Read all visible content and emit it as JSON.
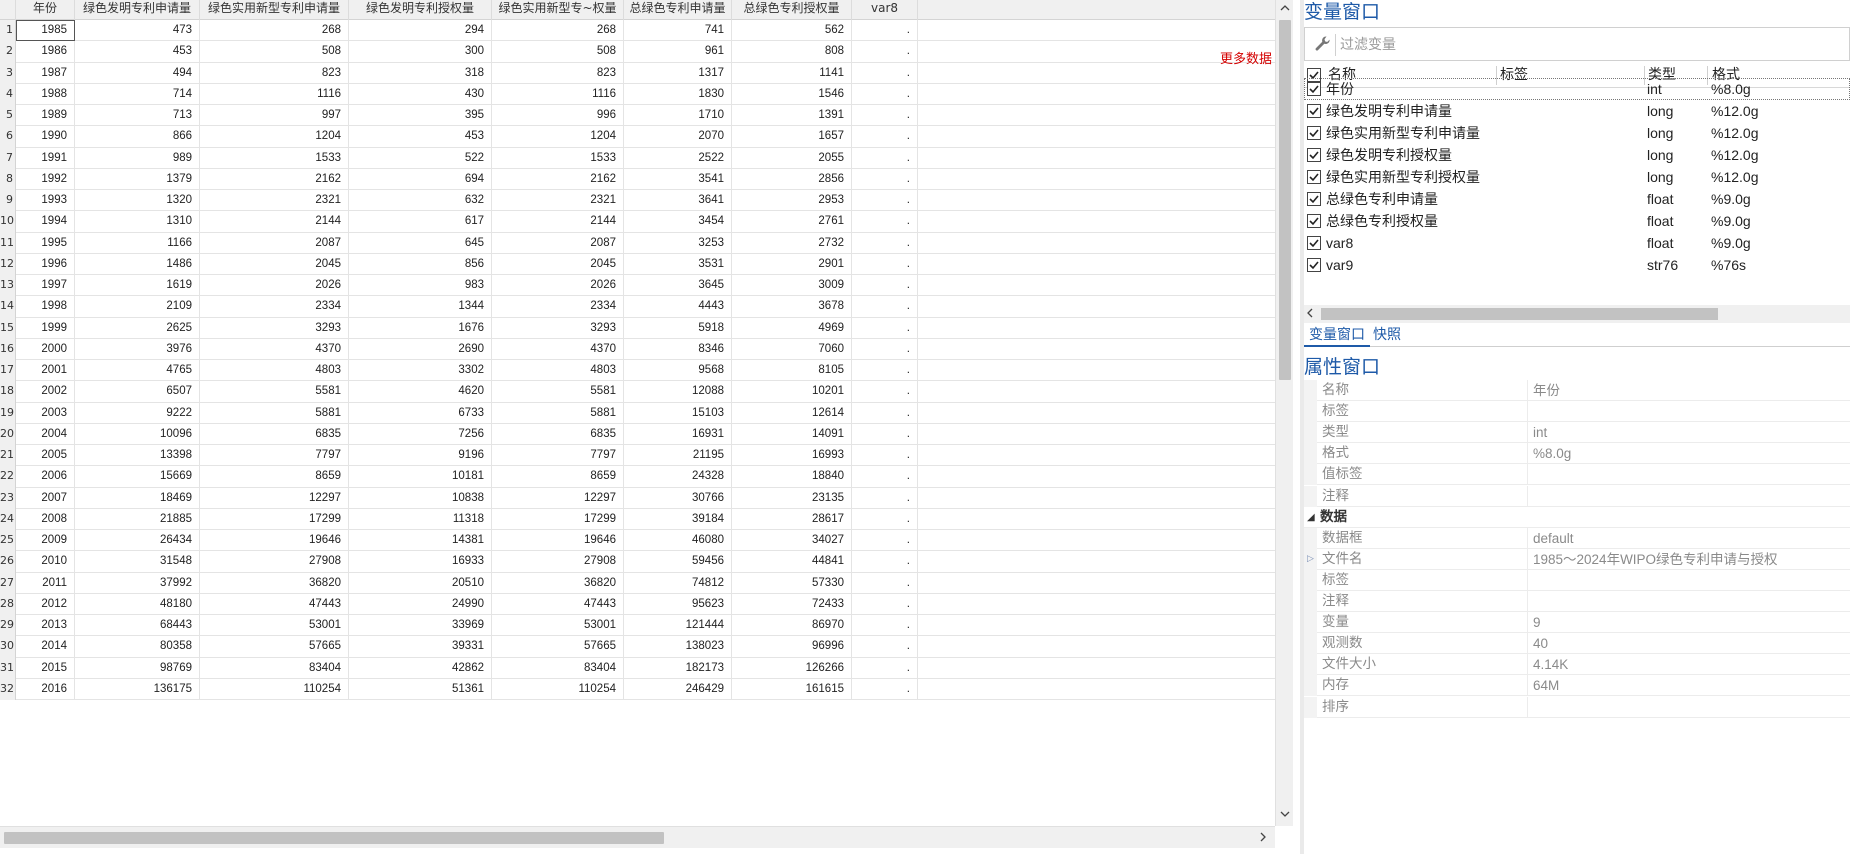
{
  "grid": {
    "columns": [
      "年份",
      "绿色发明专利申请量",
      "绿色实用新型专利申请量",
      "绿色发明专利授权量",
      "绿色实用新型专~权量",
      "总绿色专利申请量",
      "总绿色专利授权量",
      "var8"
    ],
    "rows": [
      {
        "n": "1",
        "v": [
          "1985",
          "473",
          "268",
          "294",
          "268",
          "741",
          "562",
          "."
        ]
      },
      {
        "n": "2",
        "v": [
          "1986",
          "453",
          "508",
          "300",
          "508",
          "961",
          "808",
          "."
        ]
      },
      {
        "n": "3",
        "v": [
          "1987",
          "494",
          "823",
          "318",
          "823",
          "1317",
          "1141",
          "."
        ]
      },
      {
        "n": "4",
        "v": [
          "1988",
          "714",
          "1116",
          "430",
          "1116",
          "1830",
          "1546",
          "."
        ]
      },
      {
        "n": "5",
        "v": [
          "1989",
          "713",
          "997",
          "395",
          "996",
          "1710",
          "1391",
          "."
        ]
      },
      {
        "n": "6",
        "v": [
          "1990",
          "866",
          "1204",
          "453",
          "1204",
          "2070",
          "1657",
          "."
        ]
      },
      {
        "n": "7",
        "v": [
          "1991",
          "989",
          "1533",
          "522",
          "1533",
          "2522",
          "2055",
          "."
        ]
      },
      {
        "n": "8",
        "v": [
          "1992",
          "1379",
          "2162",
          "694",
          "2162",
          "3541",
          "2856",
          "."
        ]
      },
      {
        "n": "9",
        "v": [
          "1993",
          "1320",
          "2321",
          "632",
          "2321",
          "3641",
          "2953",
          "."
        ]
      },
      {
        "n": "10",
        "v": [
          "1994",
          "1310",
          "2144",
          "617",
          "2144",
          "3454",
          "2761",
          "."
        ]
      },
      {
        "n": "11",
        "v": [
          "1995",
          "1166",
          "2087",
          "645",
          "2087",
          "3253",
          "2732",
          "."
        ]
      },
      {
        "n": "12",
        "v": [
          "1996",
          "1486",
          "2045",
          "856",
          "2045",
          "3531",
          "2901",
          "."
        ]
      },
      {
        "n": "13",
        "v": [
          "1997",
          "1619",
          "2026",
          "983",
          "2026",
          "3645",
          "3009",
          "."
        ]
      },
      {
        "n": "14",
        "v": [
          "1998",
          "2109",
          "2334",
          "1344",
          "2334",
          "4443",
          "3678",
          "."
        ]
      },
      {
        "n": "15",
        "v": [
          "1999",
          "2625",
          "3293",
          "1676",
          "3293",
          "5918",
          "4969",
          "."
        ]
      },
      {
        "n": "16",
        "v": [
          "2000",
          "3976",
          "4370",
          "2690",
          "4370",
          "8346",
          "7060",
          "."
        ]
      },
      {
        "n": "17",
        "v": [
          "2001",
          "4765",
          "4803",
          "3302",
          "4803",
          "9568",
          "8105",
          "."
        ]
      },
      {
        "n": "18",
        "v": [
          "2002",
          "6507",
          "5581",
          "4620",
          "5581",
          "12088",
          "10201",
          "."
        ]
      },
      {
        "n": "19",
        "v": [
          "2003",
          "9222",
          "5881",
          "6733",
          "5881",
          "15103",
          "12614",
          "."
        ]
      },
      {
        "n": "20",
        "v": [
          "2004",
          "10096",
          "6835",
          "7256",
          "6835",
          "16931",
          "14091",
          "."
        ]
      },
      {
        "n": "21",
        "v": [
          "2005",
          "13398",
          "7797",
          "9196",
          "7797",
          "21195",
          "16993",
          "."
        ]
      },
      {
        "n": "22",
        "v": [
          "2006",
          "15669",
          "8659",
          "10181",
          "8659",
          "24328",
          "18840",
          "."
        ]
      },
      {
        "n": "23",
        "v": [
          "2007",
          "18469",
          "12297",
          "10838",
          "12297",
          "30766",
          "23135",
          "."
        ]
      },
      {
        "n": "24",
        "v": [
          "2008",
          "21885",
          "17299",
          "11318",
          "17299",
          "39184",
          "28617",
          "."
        ]
      },
      {
        "n": "25",
        "v": [
          "2009",
          "26434",
          "19646",
          "14381",
          "19646",
          "46080",
          "34027",
          "."
        ]
      },
      {
        "n": "26",
        "v": [
          "2010",
          "31548",
          "27908",
          "16933",
          "27908",
          "59456",
          "44841",
          "."
        ]
      },
      {
        "n": "27",
        "v": [
          "2011",
          "37992",
          "36820",
          "20510",
          "36820",
          "74812",
          "57330",
          "."
        ]
      },
      {
        "n": "28",
        "v": [
          "2012",
          "48180",
          "47443",
          "24990",
          "47443",
          "95623",
          "72433",
          "."
        ]
      },
      {
        "n": "29",
        "v": [
          "2013",
          "68443",
          "53001",
          "33969",
          "53001",
          "121444",
          "86970",
          "."
        ]
      },
      {
        "n": "30",
        "v": [
          "2014",
          "80358",
          "57665",
          "39331",
          "57665",
          "138023",
          "96996",
          "."
        ]
      },
      {
        "n": "31",
        "v": [
          "2015",
          "98769",
          "83404",
          "42862",
          "83404",
          "182173",
          "126266",
          "."
        ]
      },
      {
        "n": "32",
        "v": [
          "2016",
          "136175",
          "110254",
          "51361",
          "110254",
          "246429",
          "161615",
          "."
        ]
      }
    ],
    "more_data_label": "更多数据",
    "scroll_up_icon": "chevron-up-icon",
    "scroll_down_icon": "chevron-down-icon",
    "scroll_right_icon": "chevron-right-icon"
  },
  "variables_panel": {
    "title": "变量窗口",
    "filter_placeholder": "过滤变量",
    "filter_icon": "wrench-icon",
    "headers": {
      "name": "名称",
      "label": "标签",
      "type": "类型",
      "format": "格式"
    },
    "variables": [
      {
        "name": "年份",
        "label": "",
        "type": "int",
        "format": "%8.0g",
        "checked": true
      },
      {
        "name": "绿色发明专利申请量",
        "label": "",
        "type": "long",
        "format": "%12.0g",
        "checked": true
      },
      {
        "name": "绿色实用新型专利申请量",
        "label": "",
        "type": "long",
        "format": "%12.0g",
        "checked": true
      },
      {
        "name": "绿色发明专利授权量",
        "label": "",
        "type": "long",
        "format": "%12.0g",
        "checked": true
      },
      {
        "name": "绿色实用新型专利授权量",
        "label": "",
        "type": "long",
        "format": "%12.0g",
        "checked": true
      },
      {
        "name": "总绿色专利申请量",
        "label": "",
        "type": "float",
        "format": "%9.0g",
        "checked": true
      },
      {
        "name": "总绿色专利授权量",
        "label": "",
        "type": "float",
        "format": "%9.0g",
        "checked": true
      },
      {
        "name": "var8",
        "label": "",
        "type": "float",
        "format": "%9.0g",
        "checked": true
      },
      {
        "name": "var9",
        "label": "",
        "type": "str76",
        "format": "%76s",
        "checked": true
      }
    ],
    "tabs": [
      "变量窗口",
      "快照"
    ]
  },
  "properties_panel": {
    "title": "属性窗口",
    "variable_props": [
      {
        "name": "名称",
        "value": "年份"
      },
      {
        "name": "标签",
        "value": ""
      },
      {
        "name": "类型",
        "value": "int"
      },
      {
        "name": "格式",
        "value": "%8.0g"
      },
      {
        "name": "值标签",
        "value": ""
      },
      {
        "name": "注释",
        "value": ""
      }
    ],
    "data_section_title": "数据",
    "data_props": [
      {
        "name": "数据框",
        "value": "default"
      },
      {
        "name": "文件名",
        "value": "1985～2024年WIPO绿色专利申请与授权"
      },
      {
        "name": "标签",
        "value": ""
      },
      {
        "name": "注释",
        "value": ""
      },
      {
        "name": "变量",
        "value": "9"
      },
      {
        "name": "观测数",
        "value": "40"
      },
      {
        "name": "文件大小",
        "value": "4.14K"
      },
      {
        "name": "内存",
        "value": "64M"
      },
      {
        "name": "排序",
        "value": ""
      }
    ]
  }
}
